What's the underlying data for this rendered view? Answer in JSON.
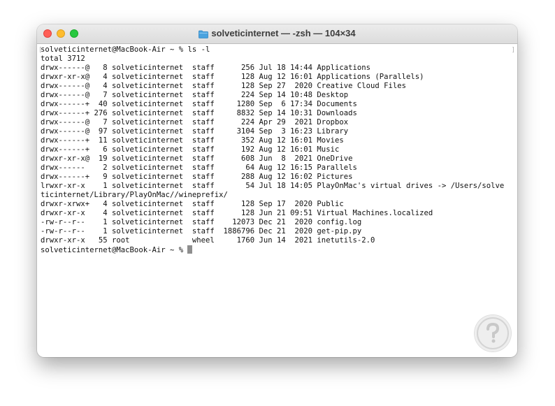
{
  "window": {
    "title": "solveticinternet — -zsh — 104×34",
    "title_icon": "folder-icon"
  },
  "terminal": {
    "lines": [
      "solveticinternet@MacBook-Air ~ % ls -l",
      "total 3712",
      "drwx------@   8 solveticinternet  staff      256 Jul 18 14:44 Applications",
      "drwxr-xr-x@   4 solveticinternet  staff      128 Aug 12 16:01 Applications (Parallels)",
      "drwx------@   4 solveticinternet  staff      128 Sep 27  2020 Creative Cloud Files",
      "drwx------@   7 solveticinternet  staff      224 Sep 14 10:48 Desktop",
      "drwx------+  40 solveticinternet  staff     1280 Sep  6 17:34 Documents",
      "drwx------+ 276 solveticinternet  staff     8832 Sep 14 10:31 Downloads",
      "drwx------@   7 solveticinternet  staff      224 Apr 29  2021 Dropbox",
      "drwx------@  97 solveticinternet  staff     3104 Sep  3 16:23 Library",
      "drwx------+  11 solveticinternet  staff      352 Aug 12 16:01 Movies",
      "drwx------+   6 solveticinternet  staff      192 Aug 12 16:01 Music",
      "drwxr-xr-x@  19 solveticinternet  staff      608 Jun  8  2021 OneDrive",
      "drwx------    2 solveticinternet  staff       64 Aug 12 16:15 Parallels",
      "drwx------+   9 solveticinternet  staff      288 Aug 12 16:02 Pictures",
      "lrwxr-xr-x    1 solveticinternet  staff       54 Jul 18 14:05 PlayOnMac's virtual drives -> /Users/solve",
      "ticinternet/Library/PlayOnMac//wineprefix/",
      "drwxr-xrwx+   4 solveticinternet  staff      128 Sep 17  2020 Public",
      "drwxr-xr-x    4 solveticinternet  staff      128 Jun 21 09:51 Virtual Machines.localized",
      "-rw-r--r--    1 solveticinternet  staff    12073 Dec 21  2020 config.log",
      "-rw-r--r--    1 solveticinternet  staff  1886796 Dec 21  2020 get-pip.py",
      "drwxr-xr-x   55 root              wheel     1760 Jun 14  2021 inetutils-2.0"
    ],
    "prompt": "solveticinternet@MacBook-Air ~ % "
  },
  "colors": {
    "close": "#ff5f57",
    "minimize": "#febc2e",
    "zoom": "#28c840",
    "folder_icon": "#4aa3df"
  }
}
